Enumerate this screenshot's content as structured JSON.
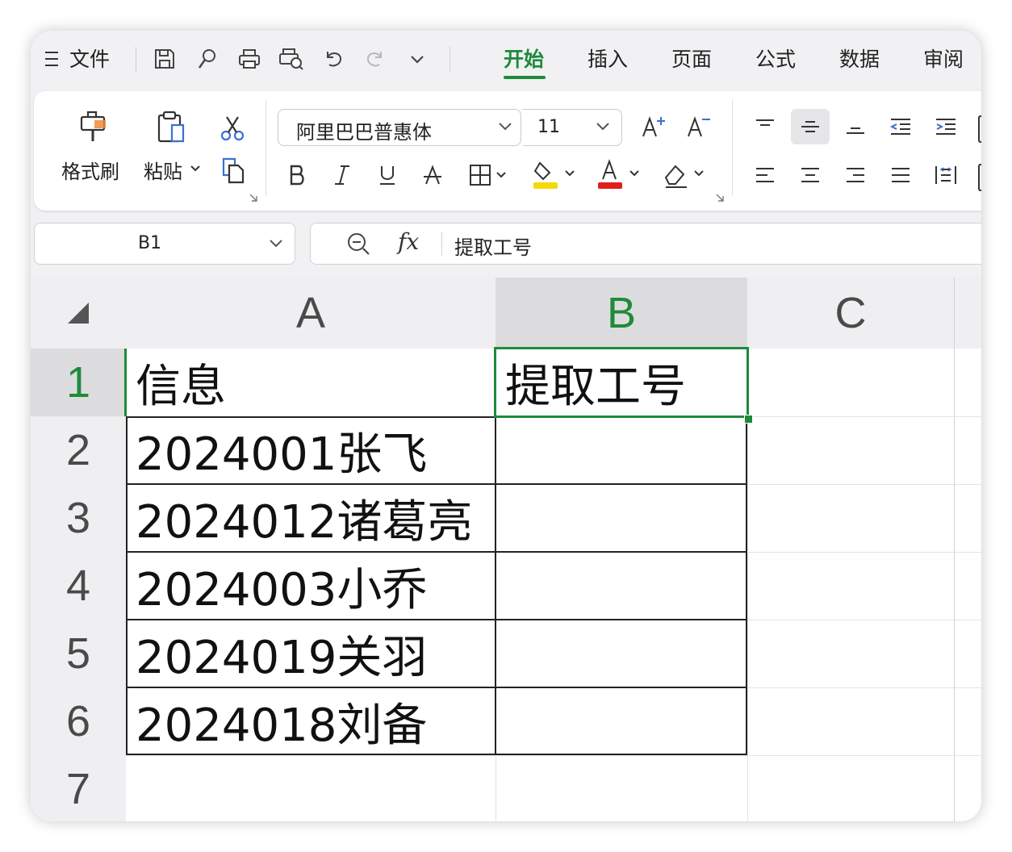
{
  "titlebar": {
    "menu_label": "文件",
    "tabs": [
      {
        "label": "开始",
        "active": true
      },
      {
        "label": "插入",
        "active": false
      },
      {
        "label": "页面",
        "active": false
      },
      {
        "label": "公式",
        "active": false
      },
      {
        "label": "数据",
        "active": false
      },
      {
        "label": "审阅",
        "active": false
      }
    ],
    "toolbar_icons": [
      "save-icon",
      "format-painter-small-icon",
      "print-icon",
      "print-preview-icon",
      "undo-icon",
      "redo-icon",
      "more-chevron-icon"
    ]
  },
  "ribbon": {
    "format_painter_label": "格式刷",
    "paste_label": "粘贴",
    "font_name": "阿里巴巴普惠体",
    "font_size": "11",
    "fill_color": "#f5d90a",
    "font_color": "#e0201b"
  },
  "formula_bar": {
    "name_box": "B1",
    "fx_label": "fx",
    "content": "提取工号"
  },
  "sheet": {
    "columns": [
      "A",
      "B",
      "C"
    ],
    "selected_column": "B",
    "selected_row": "1",
    "rows": [
      {
        "num": "1",
        "a": "信息",
        "b": "提取工号"
      },
      {
        "num": "2",
        "a": "2024001张飞",
        "b": ""
      },
      {
        "num": "3",
        "a": "2024012诸葛亮",
        "b": ""
      },
      {
        "num": "4",
        "a": "2024003小乔",
        "b": ""
      },
      {
        "num": "5",
        "a": "2024019关羽",
        "b": ""
      },
      {
        "num": "6",
        "a": "2024018刘备",
        "b": ""
      },
      {
        "num": "7",
        "a": "",
        "b": ""
      }
    ],
    "accent_color": "#1f8a3a"
  }
}
